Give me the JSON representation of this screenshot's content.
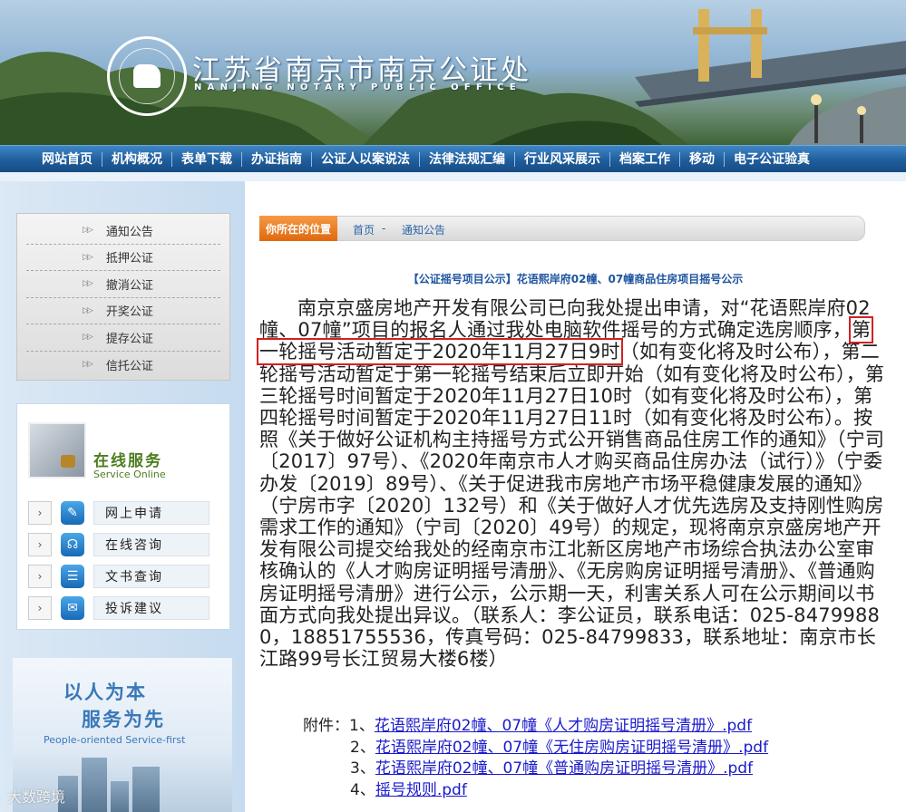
{
  "banner": {
    "title": "江苏省南京市南京公证处",
    "subtitle": "NANJING NOTARY PUBLIC OFFICE"
  },
  "nav": {
    "items": [
      "网站首页",
      "机构概况",
      "表单下载",
      "办证指南",
      "公证人以案说法",
      "法律法规汇编",
      "行业风采展示",
      "档案工作",
      "移动",
      "电子公证验真"
    ]
  },
  "sidebar": {
    "menu": [
      "通知公告",
      "抵押公证",
      "撤消公证",
      "开奖公证",
      "提存公证",
      "信托公证"
    ],
    "service": {
      "title": "在线服务",
      "subtitle": "Service Online",
      "items": [
        {
          "label": "网上申请",
          "icon": "edit-icon"
        },
        {
          "label": "在线咨询",
          "icon": "headset-icon"
        },
        {
          "label": "文书查询",
          "icon": "document-icon"
        },
        {
          "label": "投诉建议",
          "icon": "chat-icon"
        }
      ]
    },
    "motto": {
      "line1": "以人为本",
      "line2": "服务为先",
      "en": "People-oriented  Service-first"
    }
  },
  "breadcrumb": {
    "location": "你所在的位置",
    "home": "首页",
    "separator": "-",
    "current": "通知公告"
  },
  "notice": {
    "title": "【公证摇号项目公示】花语熙岸府02幢、07幢商品住房项目摇号公示",
    "body_before": "南京京盛房地产开发有限公司已向我处提出申请，对“花语熙岸府02幢、07幢”项目的报名人通过我处电脑软件摇号的方式确定选房顺序，",
    "body_highlight": "第一轮摇号活动暂定于2020年11月27日9时",
    "body_after": "（如有变化将及时公布），第二轮摇号活动暂定于第一轮摇号结束后立即开始（如有变化将及时公布），第三轮摇号时间暂定于2020年11月27日10时（如有变化将及时公布），第四轮摇号时间暂定于2020年11月27日11时（如有变化将及时公布）。按照《关于做好公证机构主持摇号方式公开销售商品住房工作的通知》（宁司〔2017〕97号）、《2020年南京市人才购买商品住房办法（试行）》（宁委办发〔2019〕89号）、《关于促进我市房地产市场平稳健康发展的通知》（宁房市字〔2020〕132号）和《关于做好人才优先选房及支持刚性购房需求工作的通知》（宁司〔2020〕49号）的规定，现将南京京盛房地产开发有限公司提交给我处的经南京市江北新区房地产市场综合执法办公室审核确认的《人才购房证明摇号清册》、《无房购房证明摇号清册》、《普通购房证明摇号清册》进行公示，公示期一天，利害关系人可在公示期间以书面方式向我处提出异议。（联系人：李公证员，联系电话：025-84799880，18851755536，传真号码：025-84799833，联系地址：南京市长江路99号长江贸易大楼6楼）"
  },
  "attachments": {
    "label": "附件：",
    "items": [
      {
        "num": "1、",
        "text": "花语熙岸府02幢、07幢《人才购房证明摇号清册》.pdf"
      },
      {
        "num": "2、",
        "text": "花语熙岸府02幢、07幢《无住房购房证明摇号清册》.pdf"
      },
      {
        "num": "3、",
        "text": "花语熙岸府02幢、07幢《普通购房证明摇号清册》.pdf"
      },
      {
        "num": "4、",
        "text": "摇号规则.pdf"
      }
    ]
  },
  "watermark": "大数跨境",
  "colors": {
    "nav": "#1f5d9c",
    "accent": "#e0680e",
    "link": "#1a1acc",
    "highlight_border": "#d42020",
    "service_green": "#4e7d1f"
  }
}
